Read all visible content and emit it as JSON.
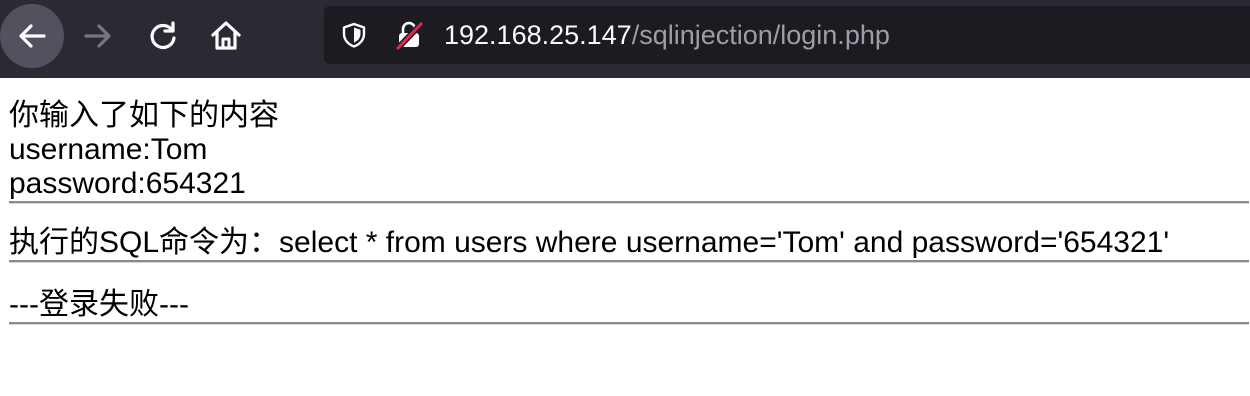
{
  "browser": {
    "url_host": "192.168.25.147",
    "url_path": "/sqlinjection/login.php",
    "icons": {
      "back": "arrow-left-icon",
      "forward": "arrow-right-icon",
      "reload": "reload-icon",
      "home": "home-icon",
      "tracking": "shield-icon",
      "insecure": "insecure-lock-icon"
    }
  },
  "page": {
    "heading": "你输入了如下的内容",
    "username_line": "username:Tom",
    "password_line": "password:654321",
    "sql_line": "执行的SQL命令为：select * from users where username='Tom' and password='654321'",
    "result_line": "---登录失败---"
  },
  "colors": {
    "toolbar_bg": "#2b2a33",
    "urlbar_bg": "#1c1b22",
    "insecure_red": "#e22850"
  }
}
